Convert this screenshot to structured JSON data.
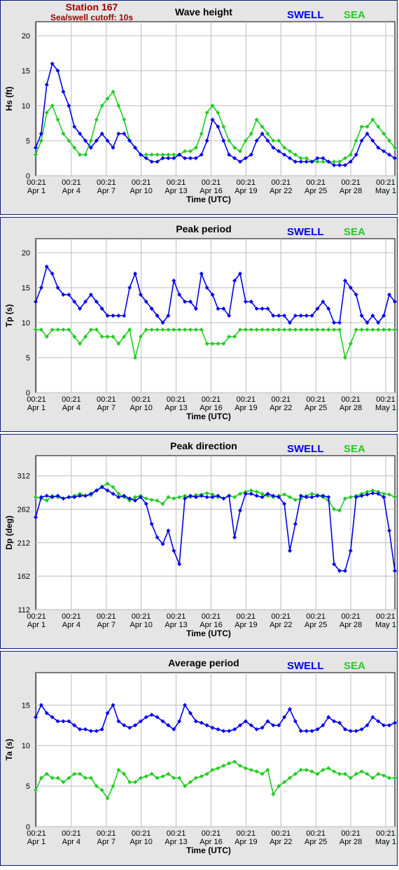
{
  "header": {
    "station": "Station 167",
    "cutoff": "Sea/swell cutoff: 10s"
  },
  "legend": {
    "swell": "SWELL",
    "sea": "SEA"
  },
  "colors": {
    "swell": "#0000ee",
    "sea": "#22cc22",
    "frame": "#0a1a7a",
    "header": "#990000",
    "plot_bg": "#ffffff",
    "panel_bg": "#e5e5e5"
  },
  "x_ticks": [
    {
      "t1": "00:21",
      "t2": "Apr 1"
    },
    {
      "t1": "00:21",
      "t2": "Apr 4"
    },
    {
      "t1": "00:21",
      "t2": "Apr 7"
    },
    {
      "t1": "00:21",
      "t2": "Apr 10"
    },
    {
      "t1": "00:21",
      "t2": "Apr 13"
    },
    {
      "t1": "00:21",
      "t2": "Apr 16"
    },
    {
      "t1": "00:21",
      "t2": "Apr 19"
    },
    {
      "t1": "00:21",
      "t2": "Apr 22"
    },
    {
      "t1": "00:21",
      "t2": "Apr 25"
    },
    {
      "t1": "00:21",
      "t2": "Apr 28"
    },
    {
      "t1": "00:21",
      "t2": "May 1"
    }
  ],
  "chart_data": [
    {
      "type": "line",
      "title": "Wave height",
      "xlabel": "Time (UTC)",
      "ylabel": "Hs (ft)",
      "ylim": [
        0,
        22
      ],
      "yticks": [
        0,
        5,
        10,
        15,
        20
      ],
      "x": [
        0,
        1,
        2,
        3,
        4,
        5,
        6,
        7,
        8,
        9,
        10,
        11,
        12,
        13,
        14,
        15,
        16,
        17,
        18,
        19,
        20,
        21,
        22,
        23,
        24,
        25,
        26,
        27,
        28,
        29,
        30,
        31,
        32,
        33,
        34,
        35,
        36,
        37,
        38,
        39,
        40,
        41,
        42,
        43,
        44,
        45,
        46,
        47,
        48,
        49,
        50,
        51,
        52,
        53,
        54,
        55,
        56,
        57,
        58,
        59,
        60,
        61,
        62,
        63,
        64,
        65
      ],
      "series": [
        {
          "name": "SWELL",
          "values": [
            4,
            6,
            13,
            16,
            15,
            12,
            10,
            7,
            6,
            5,
            4,
            5,
            6,
            5,
            4,
            6,
            6,
            5,
            4,
            3,
            2.5,
            2,
            2,
            2.5,
            2.5,
            2.5,
            3,
            2.5,
            2.5,
            2.5,
            3,
            5,
            8,
            7,
            5,
            3,
            2.5,
            2,
            2.5,
            3,
            5,
            6,
            5,
            4,
            3.5,
            3,
            2.5,
            2,
            2,
            2,
            2,
            2.5,
            2.5,
            2,
            1.5,
            1.5,
            1.5,
            2,
            3,
            5,
            6,
            5,
            4,
            3.5,
            3,
            2.5
          ]
        },
        {
          "name": "SEA",
          "values": [
            3,
            5,
            9,
            10,
            8,
            6,
            5,
            4,
            3,
            3,
            5,
            8,
            10,
            11,
            12,
            10,
            8,
            5,
            4,
            3,
            3,
            3,
            3,
            3,
            3,
            3,
            3,
            3.5,
            3.5,
            4,
            6,
            9,
            10,
            9,
            7,
            5,
            4,
            3.5,
            5,
            6,
            8,
            7,
            6,
            5,
            5,
            4,
            3.5,
            3,
            2.5,
            2.5,
            2,
            2,
            2,
            2,
            2,
            2,
            2.5,
            3,
            5,
            7,
            7,
            8,
            7,
            6,
            5,
            4
          ]
        }
      ]
    },
    {
      "type": "scatter",
      "title": "Peak period",
      "xlabel": "Time (UTC)",
      "ylabel": "Tp (s)",
      "ylim": [
        0,
        22
      ],
      "yticks": [
        0,
        5,
        10,
        15,
        20
      ],
      "x": [
        0,
        1,
        2,
        3,
        4,
        5,
        6,
        7,
        8,
        9,
        10,
        11,
        12,
        13,
        14,
        15,
        16,
        17,
        18,
        19,
        20,
        21,
        22,
        23,
        24,
        25,
        26,
        27,
        28,
        29,
        30,
        31,
        32,
        33,
        34,
        35,
        36,
        37,
        38,
        39,
        40,
        41,
        42,
        43,
        44,
        45,
        46,
        47,
        48,
        49,
        50,
        51,
        52,
        53,
        54,
        55,
        56,
        57,
        58,
        59,
        60,
        61,
        62,
        63,
        64,
        65
      ],
      "series": [
        {
          "name": "SWELL",
          "values": [
            13,
            15,
            18,
            17,
            15,
            14,
            14,
            13,
            12,
            13,
            14,
            13,
            12,
            11,
            11,
            11,
            11,
            15,
            17,
            14,
            13,
            12,
            11,
            10,
            11,
            16,
            14,
            13,
            13,
            12,
            17,
            15,
            14,
            12,
            12,
            11,
            16,
            17,
            13,
            13,
            12,
            12,
            12,
            11,
            11,
            11,
            10,
            11,
            11,
            11,
            11,
            12,
            13,
            12,
            10,
            10,
            16,
            15,
            14,
            11,
            10,
            11,
            10,
            11,
            14,
            13
          ]
        },
        {
          "name": "SEA",
          "values": [
            9,
            9,
            8,
            9,
            9,
            9,
            9,
            8,
            7,
            8,
            9,
            9,
            8,
            8,
            8,
            7,
            8,
            9,
            5,
            8,
            9,
            9,
            9,
            9,
            9,
            9,
            9,
            9,
            9,
            9,
            9,
            7,
            7,
            7,
            7,
            8,
            8,
            9,
            9,
            9,
            9,
            9,
            9,
            9,
            9,
            9,
            9,
            9,
            9,
            9,
            9,
            9,
            9,
            9,
            9,
            9,
            5,
            7,
            9,
            9,
            9,
            9,
            9,
            9,
            9,
            9
          ]
        }
      ]
    },
    {
      "type": "scatter",
      "title": "Peak direction",
      "xlabel": "Time (UTC)",
      "ylabel": "Dp (deg)",
      "ylim": [
        112,
        342
      ],
      "yticks": [
        112,
        162,
        212,
        262,
        312
      ],
      "x": [
        0,
        1,
        2,
        3,
        4,
        5,
        6,
        7,
        8,
        9,
        10,
        11,
        12,
        13,
        14,
        15,
        16,
        17,
        18,
        19,
        20,
        21,
        22,
        23,
        24,
        25,
        26,
        27,
        28,
        29,
        30,
        31,
        32,
        33,
        34,
        35,
        36,
        37,
        38,
        39,
        40,
        41,
        42,
        43,
        44,
        45,
        46,
        47,
        48,
        49,
        50,
        51,
        52,
        53,
        54,
        55,
        56,
        57,
        58,
        59,
        60,
        61,
        62,
        63,
        64,
        65
      ],
      "series": [
        {
          "name": "SWELL",
          "values": [
            250,
            280,
            282,
            280,
            282,
            278,
            280,
            280,
            282,
            282,
            285,
            290,
            295,
            290,
            285,
            280,
            282,
            278,
            275,
            280,
            270,
            240,
            220,
            210,
            230,
            200,
            180,
            278,
            282,
            280,
            282,
            280,
            280,
            282,
            278,
            282,
            220,
            260,
            285,
            285,
            282,
            280,
            285,
            282,
            280,
            270,
            200,
            240,
            282,
            280,
            280,
            282,
            282,
            280,
            180,
            170,
            170,
            200,
            280,
            282,
            284,
            286,
            285,
            280,
            230,
            170
          ]
        },
        {
          "name": "SEA",
          "values": [
            280,
            278,
            275,
            282,
            280,
            278,
            280,
            282,
            285,
            282,
            283,
            290,
            296,
            300,
            295,
            285,
            280,
            275,
            280,
            282,
            278,
            276,
            275,
            270,
            280,
            278,
            280,
            282,
            280,
            283,
            284,
            286,
            284,
            280,
            278,
            282,
            280,
            285,
            288,
            290,
            288,
            285,
            282,
            280,
            282,
            284,
            280,
            276,
            278,
            282,
            285,
            283,
            280,
            275,
            262,
            260,
            278,
            280,
            282,
            285,
            288,
            290,
            288,
            285,
            284,
            280
          ]
        }
      ]
    },
    {
      "type": "line",
      "title": "Average period",
      "xlabel": "Time (UTC)",
      "ylabel": "Ta (s)",
      "ylim": [
        0,
        19
      ],
      "yticks": [
        0,
        5,
        10,
        15
      ],
      "x": [
        0,
        1,
        2,
        3,
        4,
        5,
        6,
        7,
        8,
        9,
        10,
        11,
        12,
        13,
        14,
        15,
        16,
        17,
        18,
        19,
        20,
        21,
        22,
        23,
        24,
        25,
        26,
        27,
        28,
        29,
        30,
        31,
        32,
        33,
        34,
        35,
        36,
        37,
        38,
        39,
        40,
        41,
        42,
        43,
        44,
        45,
        46,
        47,
        48,
        49,
        50,
        51,
        52,
        53,
        54,
        55,
        56,
        57,
        58,
        59,
        60,
        61,
        62,
        63,
        64,
        65
      ],
      "series": [
        {
          "name": "SWELL",
          "values": [
            13.5,
            15,
            14,
            13.5,
            13,
            13,
            13,
            12.5,
            12,
            12,
            11.8,
            11.8,
            12,
            14,
            15,
            13,
            12.5,
            12.2,
            12.5,
            13,
            13.5,
            13.8,
            13.5,
            13,
            12.5,
            12,
            13,
            15,
            14,
            13,
            12.8,
            12.5,
            12.2,
            12,
            11.8,
            11.8,
            12,
            12.5,
            13,
            12.5,
            12,
            12.2,
            13,
            12.5,
            12.5,
            13.5,
            14.5,
            13,
            11.8,
            11.8,
            11.8,
            12,
            12.5,
            13.5,
            13,
            12.8,
            12,
            11.8,
            11.8,
            12,
            12.5,
            13.5,
            13,
            12.5,
            12.5,
            12.8
          ]
        },
        {
          "name": "SEA",
          "values": [
            4.5,
            6,
            6.5,
            6,
            6,
            5.5,
            6,
            6.5,
            6.5,
            6,
            6,
            5,
            4.5,
            3.5,
            5,
            7,
            6.5,
            5.5,
            5.5,
            6,
            6.2,
            6.5,
            6,
            6.2,
            6.5,
            6,
            6,
            5,
            5.5,
            6,
            6.2,
            6.5,
            7,
            7.2,
            7.5,
            7.8,
            8,
            7.5,
            7.2,
            7,
            6.8,
            6.5,
            7,
            4,
            5,
            5.5,
            6,
            6.5,
            7,
            7,
            6.8,
            6.5,
            7,
            7.2,
            6.8,
            6.5,
            6.5,
            6,
            6.5,
            6.8,
            6.5,
            6,
            6.5,
            6.3,
            6,
            6
          ]
        }
      ]
    }
  ]
}
